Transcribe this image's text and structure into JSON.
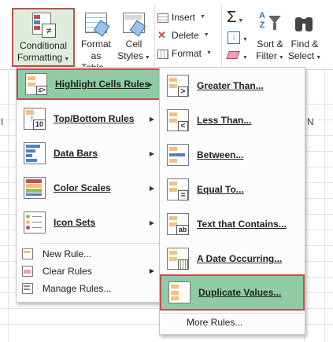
{
  "ribbon": {
    "conditional_formatting": {
      "line1": "Conditional",
      "line2": "Formatting"
    },
    "format_as_table": {
      "line1": "Format as",
      "line2": "Table"
    },
    "cell_styles": {
      "line1": "Cell",
      "line2": "Styles"
    },
    "insert_label": "Insert",
    "delete_label": "Delete",
    "format_label": "Format",
    "sort_filter": {
      "line1": "Sort &",
      "line2": "Filter"
    },
    "find_select": {
      "line1": "Find &",
      "line2": "Select"
    }
  },
  "sheet": {
    "column_header": "N"
  },
  "menu": {
    "items": [
      {
        "label": "Highlight Cells Rules"
      },
      {
        "label": "Top/Bottom Rules"
      },
      {
        "label": "Data Bars"
      },
      {
        "label": "Color Scales"
      },
      {
        "label": "Icon Sets"
      }
    ],
    "small_items": [
      {
        "label": "New Rule..."
      },
      {
        "label": "Clear Rules"
      },
      {
        "label": "Manage Rules..."
      }
    ]
  },
  "submenu": {
    "items": [
      {
        "label": "Greater Than..."
      },
      {
        "label": "Less Than..."
      },
      {
        "label": "Between..."
      },
      {
        "label": "Equal To..."
      },
      {
        "label": "Text that Contains..."
      },
      {
        "label": "A Date Occurring..."
      },
      {
        "label": "Duplicate Values..."
      }
    ],
    "more_rules": "More Rules..."
  },
  "colors": {
    "highlight": "#8fcca5",
    "highlight_border": "#c0504d",
    "menu_bg": "#fcfcfc"
  }
}
